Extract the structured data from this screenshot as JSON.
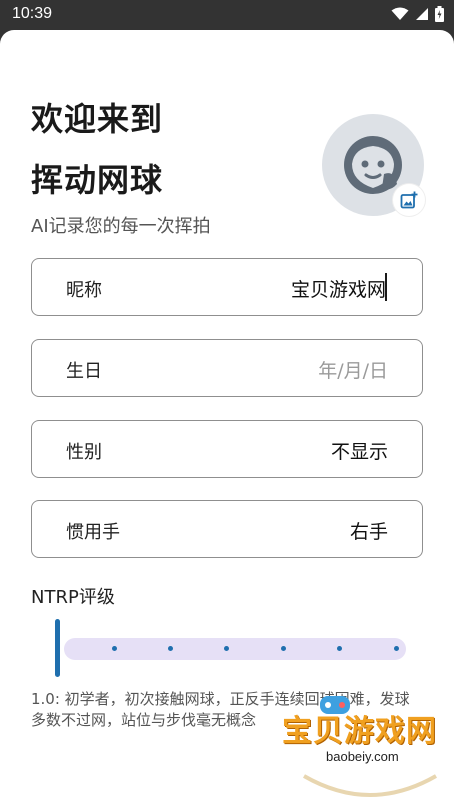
{
  "status_bar": {
    "time": "10:39",
    "icons": [
      "wifi-icon",
      "signal-icon",
      "battery-icon"
    ]
  },
  "header": {
    "title_line1": "欢迎来到",
    "title_line2": "挥动网球",
    "subtitle": "AI记录您的每一次挥拍"
  },
  "avatar": {
    "icon": "avatar-placeholder-icon",
    "badge_icon": "add-photo-icon"
  },
  "form": {
    "nickname": {
      "label": "昵称",
      "value": "宝贝游戏网"
    },
    "birthday": {
      "label": "生日",
      "placeholder": "年/月/日"
    },
    "gender": {
      "label": "性别",
      "value": "不显示"
    },
    "handedness": {
      "label": "惯用手",
      "value": "右手"
    }
  },
  "ntrp": {
    "label": "NTRP评级",
    "level": 1.0,
    "min": 1.0,
    "max": 7.0,
    "description": "1.0: 初学者，初次接触网球，正反手连续回球困难，发球多数不过网，站位与步伐毫无概念"
  },
  "watermark": {
    "text": "宝贝游戏网",
    "url": "baobeiy.com"
  },
  "colors": {
    "accent": "#1f6fae",
    "track": "#e6e0f6",
    "watermark": "#f0a020"
  }
}
